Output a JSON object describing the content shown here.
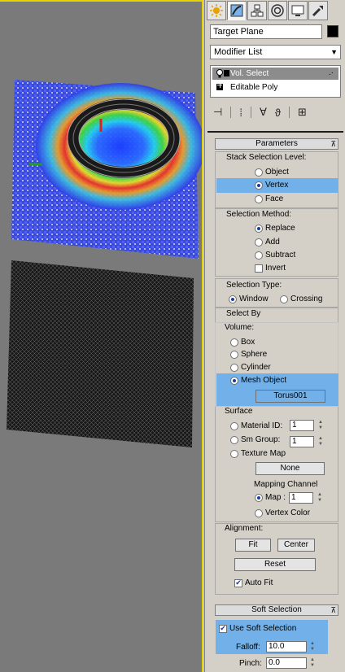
{
  "object_name": "Target Plane",
  "modifier_list": "Modifier List",
  "stack": [
    {
      "label": "Vol. Select",
      "selected": true
    },
    {
      "label": "Editable Poly",
      "selected": false
    }
  ],
  "parameters": {
    "title": "Parameters",
    "stack_selection_level": {
      "label": "Stack Selection Level:",
      "object": "Object",
      "vertex": "Vertex",
      "face": "Face"
    },
    "selection_method": {
      "label": "Selection Method:",
      "replace": "Replace",
      "add": "Add",
      "subtract": "Subtract",
      "invert": "Invert"
    },
    "selection_type": {
      "label": "Selection Type:",
      "window": "Window",
      "crossing": "Crossing"
    },
    "select_by": {
      "label": "Select By",
      "volume_label": "Volume:",
      "box": "Box",
      "sphere": "Sphere",
      "cylinder": "Cylinder",
      "mesh_object": "Mesh Object",
      "mesh_button": "Torus001"
    },
    "surface": {
      "label": "Surface",
      "material_id": "Material ID:",
      "material_id_value": "1",
      "sm_group": "Sm Group:",
      "sm_group_value": "1",
      "texture_map": "Texture Map",
      "none_button": "None",
      "mapping_channel": "Mapping Channel",
      "map": "Map :",
      "map_value": "1",
      "vertex_color": "Vertex Color"
    },
    "alignment": {
      "label": "Alignment:",
      "fit": "Fit",
      "center": "Center",
      "reset": "Reset",
      "auto_fit": "Auto Fit"
    }
  },
  "soft_selection": {
    "title": "Soft Selection",
    "use_soft_selection": "Use Soft Selection",
    "falloff_label": "Falloff:",
    "falloff_value": "10.0",
    "pinch_label": "Pinch:",
    "pinch_value": "0.0"
  },
  "colors": {
    "viewport_bg": "#7a7a7a",
    "active_border": "#e6d400",
    "highlight": "#71b0e8",
    "panel_bg": "#d4d0c8"
  }
}
